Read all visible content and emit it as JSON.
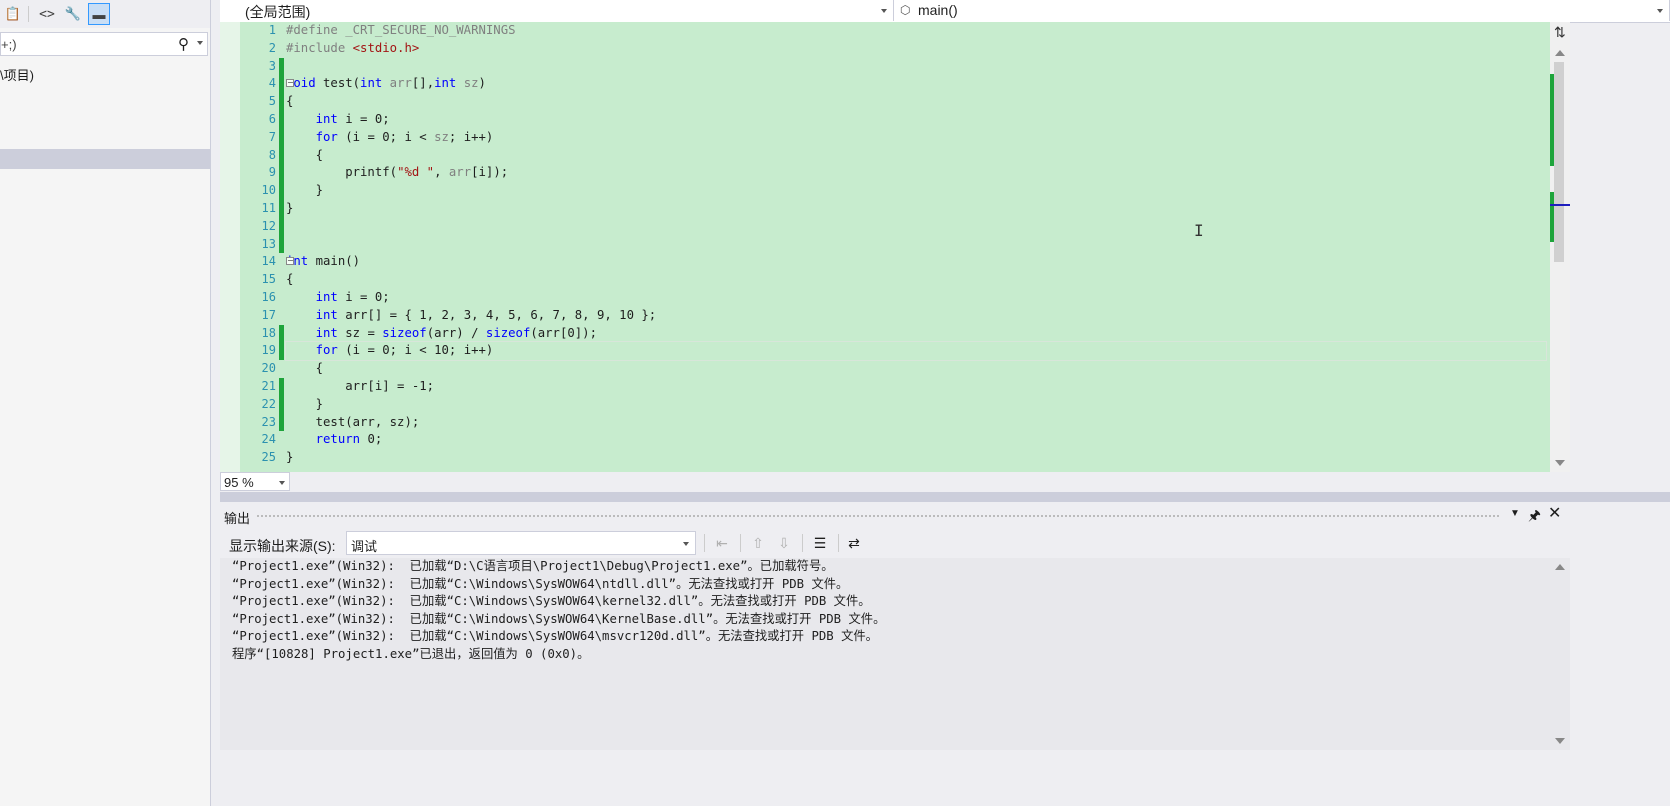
{
  "left_pane": {
    "toolbar_icons": [
      "properties-icon",
      "code-view-icon",
      "wrench-icon",
      "pin-icon"
    ],
    "search_value": "+;)",
    "tree_item": "\\项目)"
  },
  "editor": {
    "scope_dropdown": "(全局范围)",
    "function_dropdown": "main()",
    "line_numbers": [
      "1",
      "2",
      "3",
      "4",
      "5",
      "6",
      "7",
      "8",
      "9",
      "10",
      "11",
      "12",
      "13",
      "14",
      "15",
      "16",
      "17",
      "18",
      "19",
      "20",
      "21",
      "22",
      "23",
      "24",
      "25"
    ],
    "current_line": 19,
    "zoom": "95 %"
  },
  "output": {
    "title": "输出",
    "source_label": "显示输出来源(S):",
    "source_value": "调试",
    "lines": [
      "“Project1.exe”(Win32):  已加载“D:\\C语言项目\\Project1\\Debug\\Project1.exe”。已加载符号。",
      "“Project1.exe”(Win32):  已加载“C:\\Windows\\SysWOW64\\ntdll.dll”。无法查找或打开 PDB 文件。",
      "“Project1.exe”(Win32):  已加载“C:\\Windows\\SysWOW64\\kernel32.dll”。无法查找或打开 PDB 文件。",
      "“Project1.exe”(Win32):  已加载“C:\\Windows\\SysWOW64\\KernelBase.dll”。无法查找或打开 PDB 文件。",
      "“Project1.exe”(Win32):  已加载“C:\\Windows\\SysWOW64\\msvcr120d.dll”。无法查找或打开 PDB 文件。",
      "程序“[10828] Project1.exe”已退出，返回值为 0 (0x0)。"
    ]
  }
}
